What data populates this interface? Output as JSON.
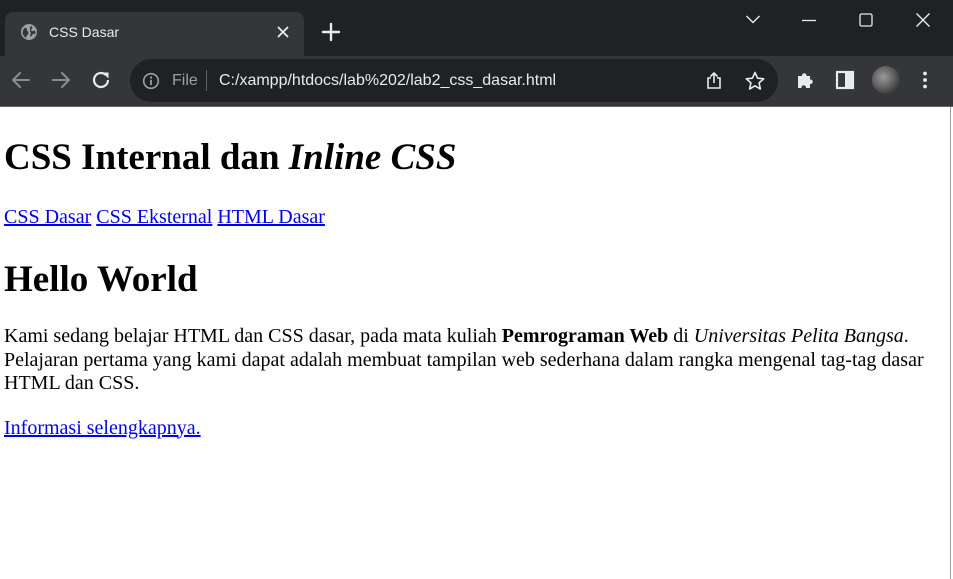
{
  "browser": {
    "tab": {
      "title": "CSS Dasar"
    },
    "address_bar": {
      "scheme_label": "File",
      "url": "C:/xampp/htdocs/lab%202/lab2_css_dasar.html"
    },
    "colors": {
      "titlebar": "#202124",
      "toolbar": "#35363a",
      "text": "#e8eaed"
    },
    "icons": [
      "globe-icon",
      "close-icon",
      "plus-icon",
      "chevron-down-icon",
      "minimize-icon",
      "maximize-icon",
      "close-window-icon",
      "back-arrow-icon",
      "forward-arrow-icon",
      "reload-icon",
      "info-icon",
      "share-icon",
      "star-icon",
      "puzzle-icon",
      "side-panel-icon",
      "avatar",
      "more-vert-icon"
    ]
  },
  "page": {
    "heading": {
      "text": "CSS Internal dan ",
      "italic": "Inline CSS"
    },
    "nav_links": [
      {
        "label": "CSS Dasar"
      },
      {
        "label": "CSS Eksternal"
      },
      {
        "label": "HTML Dasar"
      }
    ],
    "subheading": "Hello World",
    "paragraph": {
      "part1": "Kami sedang belajar HTML dan CSS dasar, pada mata kuliah ",
      "bold": "Pemrograman Web",
      "part2": " di ",
      "italic": "Universitas Pelita Bangsa",
      "part3": ". Pelajaran pertama yang kami dapat adalah membuat tampilan web sederhana dalam rangka mengenal tag-tag dasar HTML dan CSS."
    },
    "more_link": "Informasi selengkapnya.",
    "colors": {
      "link": "#0000ee",
      "text": "#000000",
      "background": "#ffffff"
    }
  }
}
